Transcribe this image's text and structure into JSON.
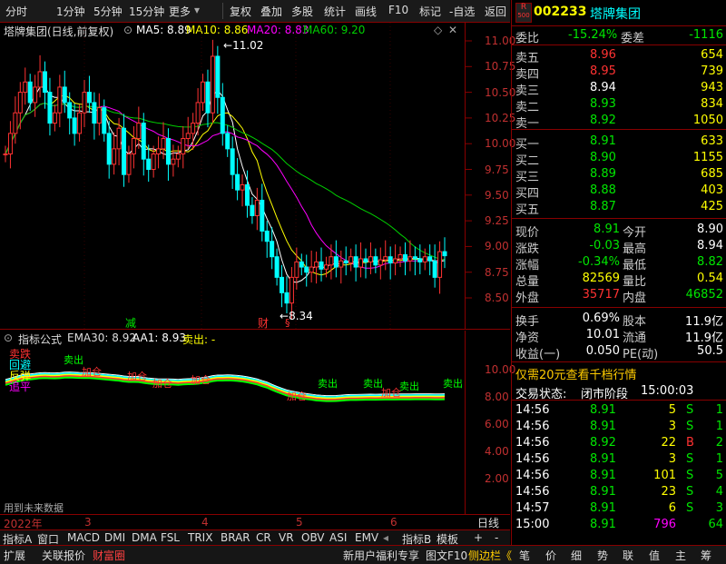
{
  "toolbar": {
    "items": [
      "分时",
      "1分钟",
      "5分钟",
      "15分钟",
      "更多",
      "复权",
      "叠加",
      "多股",
      "统计",
      "画线",
      "F10",
      "标记",
      "-自选",
      "返回"
    ]
  },
  "kchart": {
    "title": "塔牌集团(日线,前复权)",
    "ma5_label": "MA5: 8.89",
    "ma10_label": "MA10: 8.86",
    "ma20_label": "MA20: 8.83",
    "ma60_label": "MA60: 9.20",
    "high_marker": "11.02",
    "low_marker": "8.34",
    "event_jian": "减",
    "event_cai": "财",
    "event_s": "§",
    "yticks": [
      "11.00",
      "10.75",
      "10.50",
      "10.25",
      "10.00",
      "9.75",
      "9.50",
      "9.25",
      "9.00",
      "8.75",
      "8.50"
    ],
    "colors": {
      "ma5": "#ffffff",
      "ma10": "#ffff00",
      "ma20": "#ff00ff",
      "ma60": "#00d000",
      "up": "#ff3232",
      "down": "#00ffff"
    }
  },
  "indicator": {
    "name": "指标公式",
    "ema_label": "EMA30: 8.92",
    "aa1_label": "AA1: 8.93",
    "sell_label": "卖出: -",
    "legend": [
      "卖跌",
      "回避",
      "反弹",
      "追平"
    ],
    "sell_tags": [
      "卖出",
      "卖出",
      "卖出",
      "卖出",
      "卖出"
    ],
    "add_tags": [
      "加仓",
      "加仓",
      "加仓",
      "加仓",
      "加仓",
      "加仓"
    ],
    "yticks": [
      "10.00",
      "8.00",
      "6.00",
      "4.00",
      "2.00"
    ],
    "note": "用到未来数据"
  },
  "xaxis": {
    "year": "2022年",
    "months": [
      "3",
      "4",
      "5",
      "6"
    ],
    "period": "日线"
  },
  "tabs": [
    "指标A",
    "窗口",
    "MACD",
    "DMI",
    "DMA",
    "FSL",
    "TRIX",
    "BRAR",
    "CR",
    "VR",
    "OBV",
    "ASI",
    "EMV",
    "指标B",
    "模板",
    "+",
    "-"
  ],
  "status_bar": {
    "left": [
      "扩展",
      "关联报价",
      "财富圈"
    ],
    "middle": [
      "新用户福利专享",
      "图文F10",
      "侧边栏《"
    ],
    "right": [
      "笔",
      "价",
      "细",
      "势",
      "联",
      "值",
      "主",
      "筹"
    ]
  },
  "stock": {
    "market_badge_top": "R",
    "market_badge_bottom": "500",
    "code": "002233",
    "name": "塔牌集团"
  },
  "weibi": {
    "label": "委比",
    "value": "-15.24%",
    "diff_label": "委差",
    "diff_value": "-1116"
  },
  "asks": [
    {
      "label": "卖五",
      "price": "8.96",
      "vol": "654"
    },
    {
      "label": "卖四",
      "price": "8.95",
      "vol": "739"
    },
    {
      "label": "卖三",
      "price": "8.94",
      "vol": "943"
    },
    {
      "label": "卖二",
      "price": "8.93",
      "vol": "834"
    },
    {
      "label": "卖一",
      "price": "8.92",
      "vol": "1050"
    }
  ],
  "bids": [
    {
      "label": "买一",
      "price": "8.91",
      "vol": "633"
    },
    {
      "label": "买二",
      "price": "8.90",
      "vol": "1155"
    },
    {
      "label": "买三",
      "price": "8.89",
      "vol": "685"
    },
    {
      "label": "买四",
      "price": "8.88",
      "vol": "403"
    },
    {
      "label": "买五",
      "price": "8.87",
      "vol": "425"
    }
  ],
  "quote": [
    {
      "l1": "现价",
      "v1": "8.91",
      "l2": "今开",
      "v2": "8.90"
    },
    {
      "l1": "涨跌",
      "v1": "-0.03",
      "l2": "最高",
      "v2": "8.94"
    },
    {
      "l1": "涨幅",
      "v1": "-0.34%",
      "l2": "最低",
      "v2": "8.82"
    },
    {
      "l1": "总量",
      "v1": "82569",
      "l2": "量比",
      "v2": "0.54"
    },
    {
      "l1": "外盘",
      "v1": "35717",
      "l2": "内盘",
      "v2": "46852"
    }
  ],
  "fin": [
    {
      "l1": "换手",
      "v1": "0.69%",
      "l2": "股本",
      "v2": "11.9亿"
    },
    {
      "l1": "净资",
      "v1": "10.01",
      "l2": "流通",
      "v2": "11.9亿"
    },
    {
      "l1": "收益(一)",
      "v1": "0.050",
      "l2": "PE(动)",
      "v2": "50.5"
    }
  ],
  "promo": "仅需20元查看千档行情",
  "trade_status": {
    "label": "交易状态:",
    "value": "闭市阶段",
    "time": "15:00:03"
  },
  "ticks": [
    {
      "time": "14:56",
      "price": "8.91",
      "vol": "5",
      "side": "S",
      "n": "1"
    },
    {
      "time": "14:56",
      "price": "8.91",
      "vol": "3",
      "side": "S",
      "n": "1"
    },
    {
      "time": "14:56",
      "price": "8.92",
      "vol": "22",
      "side": "B",
      "n": "2"
    },
    {
      "time": "14:56",
      "price": "8.91",
      "vol": "3",
      "side": "S",
      "n": "1"
    },
    {
      "time": "14:56",
      "price": "8.91",
      "vol": "101",
      "side": "S",
      "n": "5"
    },
    {
      "time": "14:56",
      "price": "8.91",
      "vol": "23",
      "side": "S",
      "n": "4"
    },
    {
      "time": "14:57",
      "price": "8.91",
      "vol": "6",
      "side": "S",
      "n": "3"
    },
    {
      "time": "15:00",
      "price": "8.91",
      "vol": "796",
      "side": "",
      "n": "64"
    }
  ]
}
